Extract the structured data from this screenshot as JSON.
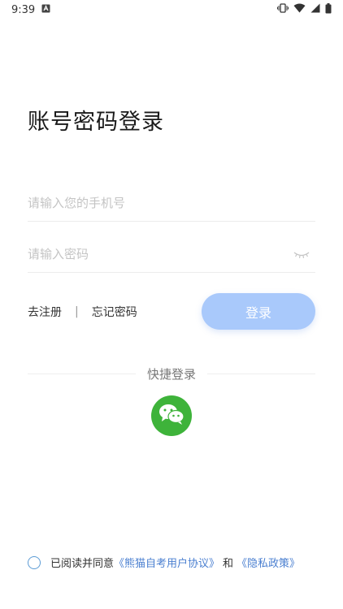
{
  "status_bar": {
    "time": "9:39",
    "icons": [
      "notification-a-icon",
      "vibrate-icon",
      "wifi-icon",
      "signal-icon",
      "battery-icon"
    ]
  },
  "title": "账号密码登录",
  "phone_input": {
    "placeholder": "请输入您的手机号",
    "value": ""
  },
  "password_input": {
    "placeholder": "请输入密码",
    "value": ""
  },
  "links": {
    "register": "去注册",
    "divider": "|",
    "forgot": "忘记密码"
  },
  "login_button": {
    "label": "登录",
    "color": "#a9c9fb"
  },
  "quick_login": {
    "label": "快捷登录",
    "wechat_color": "#3eb33a"
  },
  "agreement": {
    "prefix": "已阅读并同意",
    "user_agreement": "《熊猫自考用户协议》",
    "and": "和",
    "privacy_policy": "《隐私政策》",
    "link_color": "#4a7fd0"
  }
}
